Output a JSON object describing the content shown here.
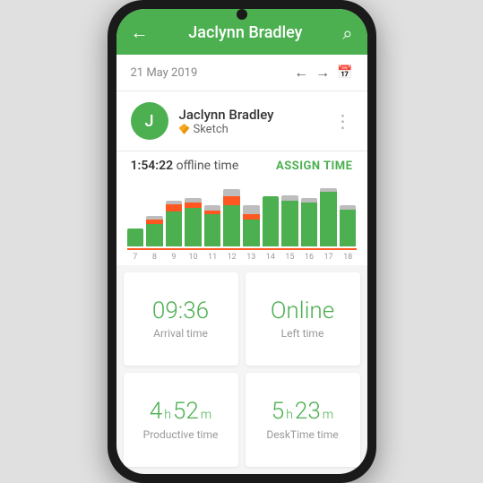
{
  "header": {
    "back_icon": "←",
    "title": "Jaclynn Bradley",
    "search_icon": "🔍"
  },
  "date_bar": {
    "date": "21 May 2019",
    "prev_icon": "←",
    "next_icon": "→",
    "calendar_icon": "📅"
  },
  "user": {
    "avatar_letter": "J",
    "name": "Jaclynn Bradley",
    "role": "Sketch",
    "menu_icon": "⋮"
  },
  "stats": {
    "offline_time": "1:54:22",
    "offline_label": "offline time",
    "assign_btn": "ASSIGN TIME"
  },
  "chart": {
    "bars": [
      {
        "green": 20,
        "orange": 0,
        "gray": 0,
        "label": "7"
      },
      {
        "green": 25,
        "orange": 5,
        "gray": 3,
        "label": "8"
      },
      {
        "green": 38,
        "orange": 8,
        "gray": 4,
        "label": "9"
      },
      {
        "green": 42,
        "orange": 6,
        "gray": 5,
        "label": "10"
      },
      {
        "green": 35,
        "orange": 4,
        "gray": 6,
        "label": "11"
      },
      {
        "green": 45,
        "orange": 10,
        "gray": 8,
        "label": "12"
      },
      {
        "green": 30,
        "orange": 5,
        "gray": 10,
        "label": "13"
      },
      {
        "green": 55,
        "orange": 0,
        "gray": 0,
        "label": "14"
      },
      {
        "green": 50,
        "orange": 0,
        "gray": 6,
        "label": "15"
      },
      {
        "green": 48,
        "orange": 0,
        "gray": 5,
        "label": "16"
      },
      {
        "green": 60,
        "orange": 0,
        "gray": 4,
        "label": "17"
      },
      {
        "green": 40,
        "orange": 0,
        "gray": 5,
        "label": "18"
      }
    ],
    "colors": {
      "green": "#4caf50",
      "orange": "#ff5722",
      "gray": "#bdbdbd"
    }
  },
  "cards": [
    {
      "id": "arrival",
      "value": "09:36",
      "label": "Arrival time",
      "type": "time"
    },
    {
      "id": "online",
      "value": "Online",
      "label": "Left time",
      "type": "status"
    },
    {
      "id": "productive",
      "hours": "4",
      "minutes": "52",
      "label": "Productive time",
      "type": "duration"
    },
    {
      "id": "desktime",
      "hours": "5",
      "minutes": "23",
      "label": "DeskTime time",
      "type": "duration"
    }
  ]
}
